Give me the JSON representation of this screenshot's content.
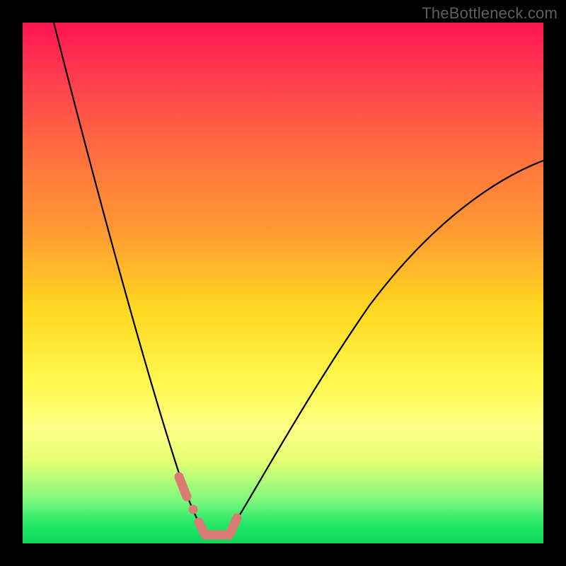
{
  "watermark": "TheBottleneck.com",
  "chart_data": {
    "type": "line",
    "title": "",
    "xlabel": "",
    "ylabel": "",
    "xlim": [
      0,
      100
    ],
    "ylim": [
      0,
      100
    ],
    "note": "V-shaped bottleneck curve over red-to-green vertical gradient; no axis tick labels visible",
    "series": [
      {
        "name": "left-branch",
        "x": [
          5,
          10,
          15,
          20,
          25,
          28,
          30,
          32,
          33.5
        ],
        "y": [
          100,
          78,
          56,
          36,
          19,
          11,
          6.5,
          3,
          1.5
        ]
      },
      {
        "name": "right-branch",
        "x": [
          38,
          42,
          48,
          55,
          63,
          72,
          82,
          92,
          100
        ],
        "y": [
          1.5,
          3.5,
          9,
          17,
          27,
          39,
          52,
          63,
          72
        ]
      },
      {
        "name": "trough-marker",
        "x": [
          29,
          30,
          31,
          32,
          33,
          34,
          35,
          36,
          37,
          38,
          39,
          40
        ],
        "y": [
          11,
          8,
          5.5,
          3.5,
          2,
          1.2,
          1.0,
          1.0,
          1.2,
          1.8,
          3.0,
          5.0
        ]
      }
    ]
  },
  "colors": {
    "curve": "#000000",
    "marker": "#da7a73"
  }
}
